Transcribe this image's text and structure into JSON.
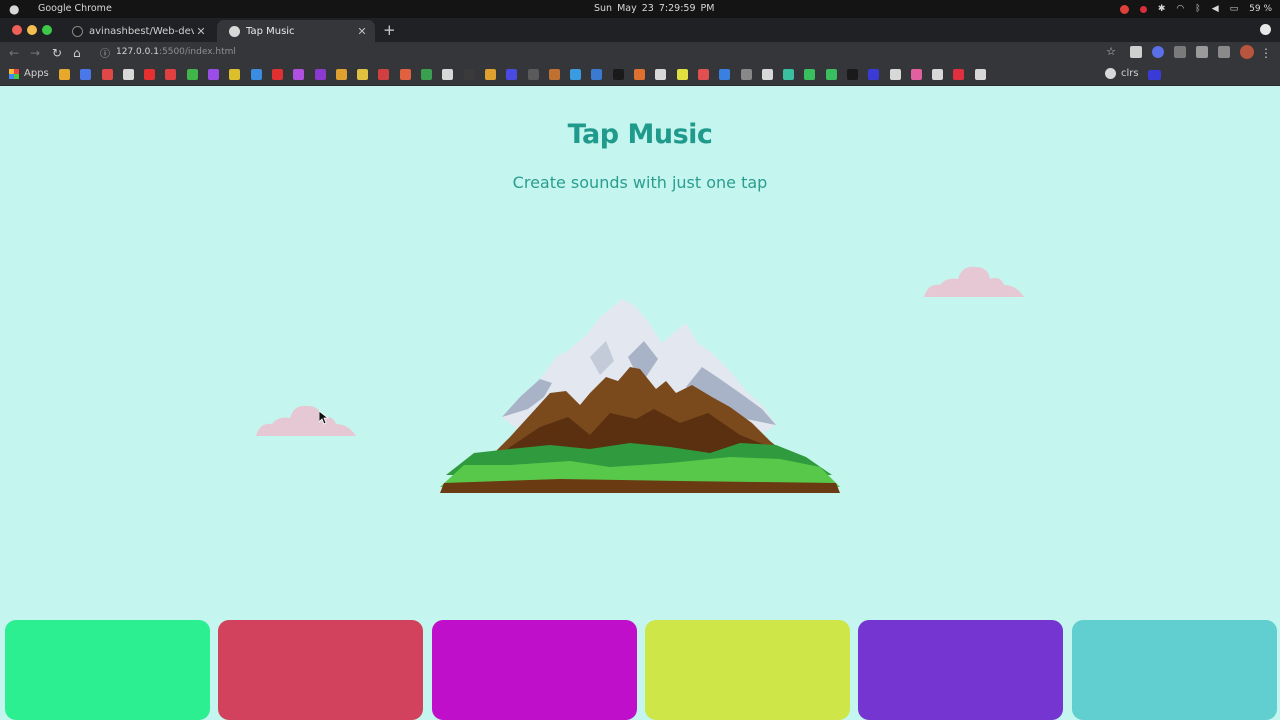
{
  "os": {
    "app_name": "Google Chrome",
    "clock": "Sun May 23   7:29:59 PM",
    "battery": "59 %"
  },
  "tabs": [
    {
      "title": "avinashbest/Web-dev-Pro",
      "active": false
    },
    {
      "title": "Tap Music",
      "active": true
    }
  ],
  "address_bar": {
    "host": "127.0.0.1",
    "path": ":5500/index.html"
  },
  "bookmarks": {
    "apps_label": "Apps",
    "clrs_label": "clrs",
    "icon_colors": [
      "#e6a92b",
      "#4a78e8",
      "#e04848",
      "#d8d8d8",
      "#e53030",
      "#e04040",
      "#3fb54a",
      "#9b4de8",
      "#dcbf2c",
      "#3a8de0",
      "#e03030",
      "#b050e0",
      "#8a3ad0",
      "#e0a030",
      "#e0c040",
      "#d04040",
      "#e06040",
      "#3aa050",
      "#d8d8d8",
      "#3a3a3a",
      "#e0a030",
      "#4a4ae0",
      "#5a5a5a",
      "#c07030",
      "#3a9be0",
      "#3a7ad0",
      "#1a1a1a",
      "#e07030",
      "#d8d8d8",
      "#e0e040",
      "#e05050",
      "#3a80e0",
      "#888888",
      "#d8d8d8",
      "#3abfa0",
      "#3abf60",
      "#3abf60",
      "#1a1a1a",
      "#3a3ad6",
      "#d8d8d8",
      "#e060a0",
      "#d8d8d8",
      "#e03040",
      "#d8d8d8"
    ]
  },
  "page": {
    "title": "Tap Music",
    "subtitle": "Create sounds with just one tap"
  },
  "pads": [
    {
      "color": "#2cef92",
      "name": "pad-1"
    },
    {
      "color": "#d2425c",
      "name": "pad-2"
    },
    {
      "color": "#c00fcb",
      "name": "pad-3"
    },
    {
      "color": "#cfe649",
      "name": "pad-4"
    },
    {
      "color": "#7535d0",
      "name": "pad-5"
    },
    {
      "color": "#61ced0",
      "name": "pad-6"
    }
  ],
  "colors": {
    "page_background": "#c4f5ee",
    "title": "#1f9a8c",
    "cloud": "#e6c8d4"
  }
}
